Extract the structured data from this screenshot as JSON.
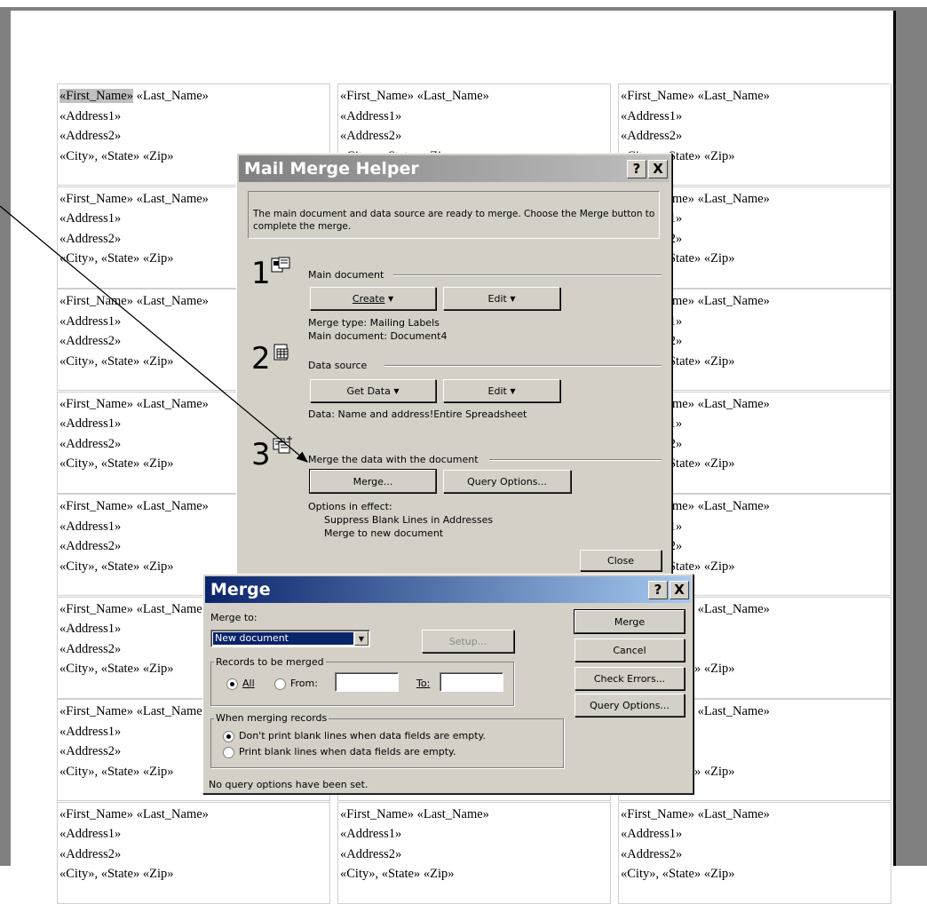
{
  "document": {
    "label_lines": {
      "first": "«First_Name»",
      "name_rest": " «Last_Name»",
      "name": "«First_Name» «Last_Name»",
      "addr1": "«Address1»",
      "addr2": "«Address2»",
      "city": "«City», «State» «Zip»"
    },
    "partial_right": {
      "name": "ame» «Last_Name»",
      "addr1": "1»",
      "addr2": "2»",
      "city": "State» «Zip»",
      "name2": "» «Last_Name»",
      "city2": "te» «Zip»"
    },
    "partial_left": {
      "name": "«First_Name» «Last_Name»",
      "name_short": "«First_Name» «Last_N"
    }
  },
  "helper": {
    "title": "Mail Merge Helper",
    "help_glyph": "?",
    "close_glyph": "X",
    "intro": "The main document and data source are ready to merge. Choose the Merge button to complete the merge.",
    "step1": {
      "number": "1",
      "heading": "Main document",
      "create": "Create",
      "edit": "Edit",
      "merge_type": "Merge type: Mailing Labels",
      "main_doc": "Main document: Document4"
    },
    "step2": {
      "number": "2",
      "heading": "Data source",
      "get_data": "Get Data",
      "edit": "Edit",
      "data": "Data: Name and address!Entire Spreadsheet"
    },
    "step3": {
      "number": "3",
      "heading": "Merge the data with the document",
      "merge": "Merge...",
      "query": "Query Options...",
      "options_label": "Options in effect:",
      "option1": "Suppress Blank Lines in Addresses",
      "option2": "Merge to new document"
    },
    "close_button": "Close"
  },
  "merge": {
    "title": "Merge",
    "help_glyph": "?",
    "close_glyph": "X",
    "merge_to_label": "Merge to:",
    "merge_to_value": "New document",
    "setup": "Setup...",
    "records_group": "Records to be merged",
    "all": "All",
    "from": "From:",
    "to": "To:",
    "when_group": "When merging records",
    "opt_dont": "Don't print blank lines when data fields are empty.",
    "opt_print": "Print blank lines when data fields are empty.",
    "status": "No query options have been set.",
    "btn_merge": "Merge",
    "btn_cancel": "Cancel",
    "btn_check": "Check Errors...",
    "btn_query": "Query Options..."
  }
}
